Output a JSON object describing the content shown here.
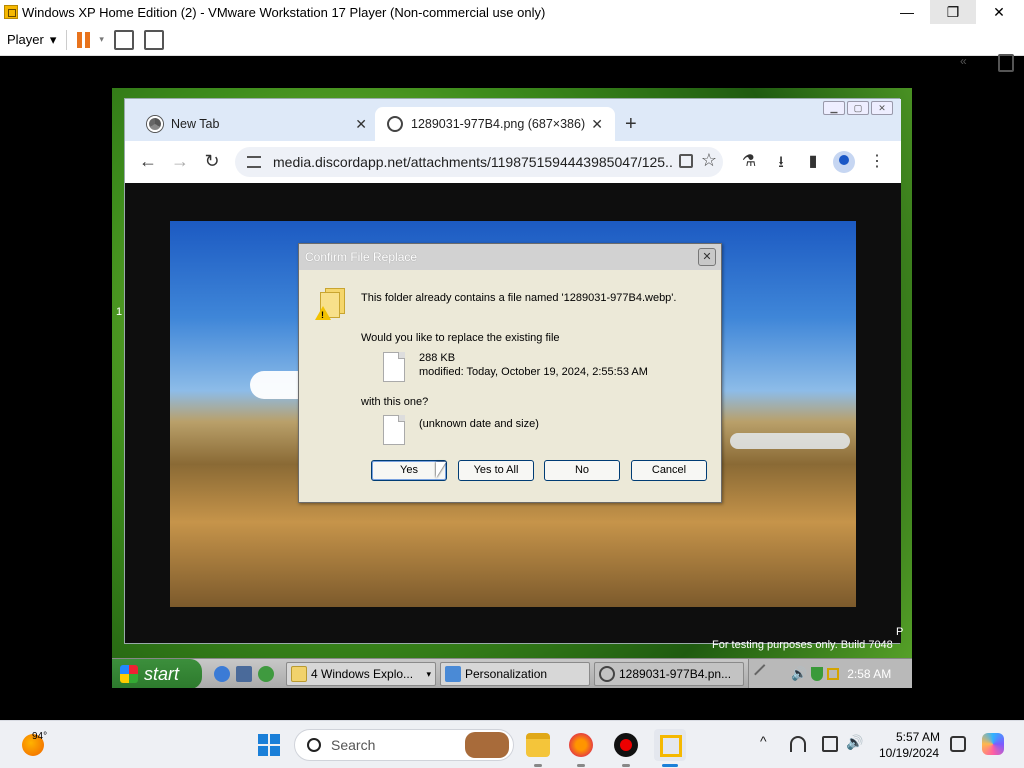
{
  "vmware": {
    "title": "Windows XP Home Edition (2) - VMware Workstation 17 Player (Non-commercial use only)",
    "window_controls": {
      "minimize": "—",
      "maximize": "❐",
      "close": "✕"
    },
    "toolbar": {
      "player_label": "Player",
      "dropdown_arrow": "▾",
      "collapse_label": "«"
    }
  },
  "chrome": {
    "tabs": [
      {
        "label": "New Tab",
        "close": "✕"
      },
      {
        "label": "1289031-977B4.png (687×386)",
        "close": "✕"
      }
    ],
    "new_tab": "+",
    "window_controls": {
      "minimize": "▁",
      "maximize": "▢",
      "close": "✕"
    },
    "nav": {
      "back": "←",
      "forward": "→",
      "reload": "↻"
    },
    "url": "media.discordapp.net/attachments/1198751594443985047/125...",
    "toolbar_icons": {
      "star": "☆",
      "lab": "⚗",
      "download": "⭳",
      "sidepanel": "▮",
      "menu": "⋮"
    }
  },
  "dialog": {
    "title": "Confirm File Replace",
    "close": "✕",
    "message_contains": "This folder already contains a file named '1289031-977B4.webp'.",
    "message_replace": "Would you like to replace the existing file",
    "existing_size": "288 KB",
    "existing_modified": "modified: Today, October 19, 2024, 2:55:53 AM",
    "message_with": "with this one?",
    "new_info": "(unknown date and size)",
    "buttons": {
      "yes": "Yes",
      "yes_to_all": "Yes to All",
      "no": "No",
      "cancel": "Cancel"
    }
  },
  "xp_desktop": {
    "watermark": "For testing purposes only. Build 7048",
    "watermark_edge": "P",
    "left_edge_mark": "1"
  },
  "xp_taskbar": {
    "start_label": "start",
    "tasks": [
      {
        "label": "4 Windows Explo...",
        "dropdown": "▾"
      },
      {
        "label": "Personalization"
      },
      {
        "label": "1289031-977B4.pn..."
      }
    ],
    "tray_volume": "🔊",
    "clock": "2:58 AM"
  },
  "host_taskbar": {
    "weather_temp": "94°",
    "search_label": "Search",
    "tray_chevron": "^",
    "tray_speaker": "🔊",
    "time": "5:57 AM",
    "date": "10/19/2024"
  },
  "colors": {
    "dialog_bg": "#ece9d8",
    "chrome_tabstrip": "#dee9f8",
    "xp_start_green": "#3c8f3c",
    "vmware_pause_orange": "#e8731d"
  }
}
